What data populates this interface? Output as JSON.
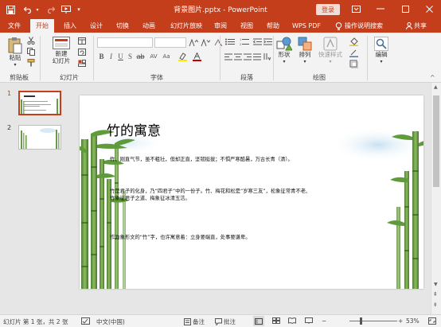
{
  "app": {
    "document_title": "背景图片.pptx - PowerPoint",
    "login_label": "登录",
    "accent_color": "#c43e1c"
  },
  "quick_access": {
    "icons": [
      "save-icon",
      "undo-icon",
      "redo-icon",
      "slideshow-start-icon",
      "customize-icon"
    ]
  },
  "tabs": [
    {
      "label": "文件",
      "active": false
    },
    {
      "label": "开始",
      "active": true
    },
    {
      "label": "插入",
      "active": false
    },
    {
      "label": "设计",
      "active": false
    },
    {
      "label": "切换",
      "active": false
    },
    {
      "label": "动画",
      "active": false
    },
    {
      "label": "幻灯片放映",
      "active": false
    },
    {
      "label": "审阅",
      "active": false
    },
    {
      "label": "视图",
      "active": false
    },
    {
      "label": "帮助",
      "active": false
    },
    {
      "label": "WPS PDF",
      "active": false
    }
  ],
  "tell_me": "操作说明搜索",
  "share": "共享",
  "ribbon": {
    "clipboard": {
      "paste": "粘贴",
      "group": "剪贴板"
    },
    "slides": {
      "new_slide": "新建\n幻灯片",
      "group": "幻灯片"
    },
    "font": {
      "group": "字体"
    },
    "paragraph": {
      "group": "段落"
    },
    "drawing": {
      "shape": "形状",
      "arrange": "排列",
      "quick_styles": "快速样式",
      "group": "绘图"
    },
    "editing": {
      "label": "编辑"
    }
  },
  "thumbnails": [
    {
      "number": "1",
      "selected": true
    },
    {
      "number": "2",
      "selected": false
    }
  ],
  "slide": {
    "title": "竹的寓意",
    "paragraphs": [
      "竹，刚直气节，虽不粗壮，但却正直，坚韧挺拔；不惧严寒酷暑，万古长青（清）。",
      "竹是君子的化身，乃“四君子”中的一份子。竹、梅花和松是“岁寒三友”，松象征常青不老、",
      "竹象征君子之道、梅象征冰清玉洁。",
      "作为象形文的“竹”字，也许寓意着：立身要端直，处事要谦卑。"
    ]
  },
  "status": {
    "slide_info": "幻灯片 第 1 张，共 2 张",
    "language": "中文(中国)",
    "notes": "备注",
    "comments": "批注",
    "zoom": "53%",
    "zoom_fraction": 0.53
  }
}
